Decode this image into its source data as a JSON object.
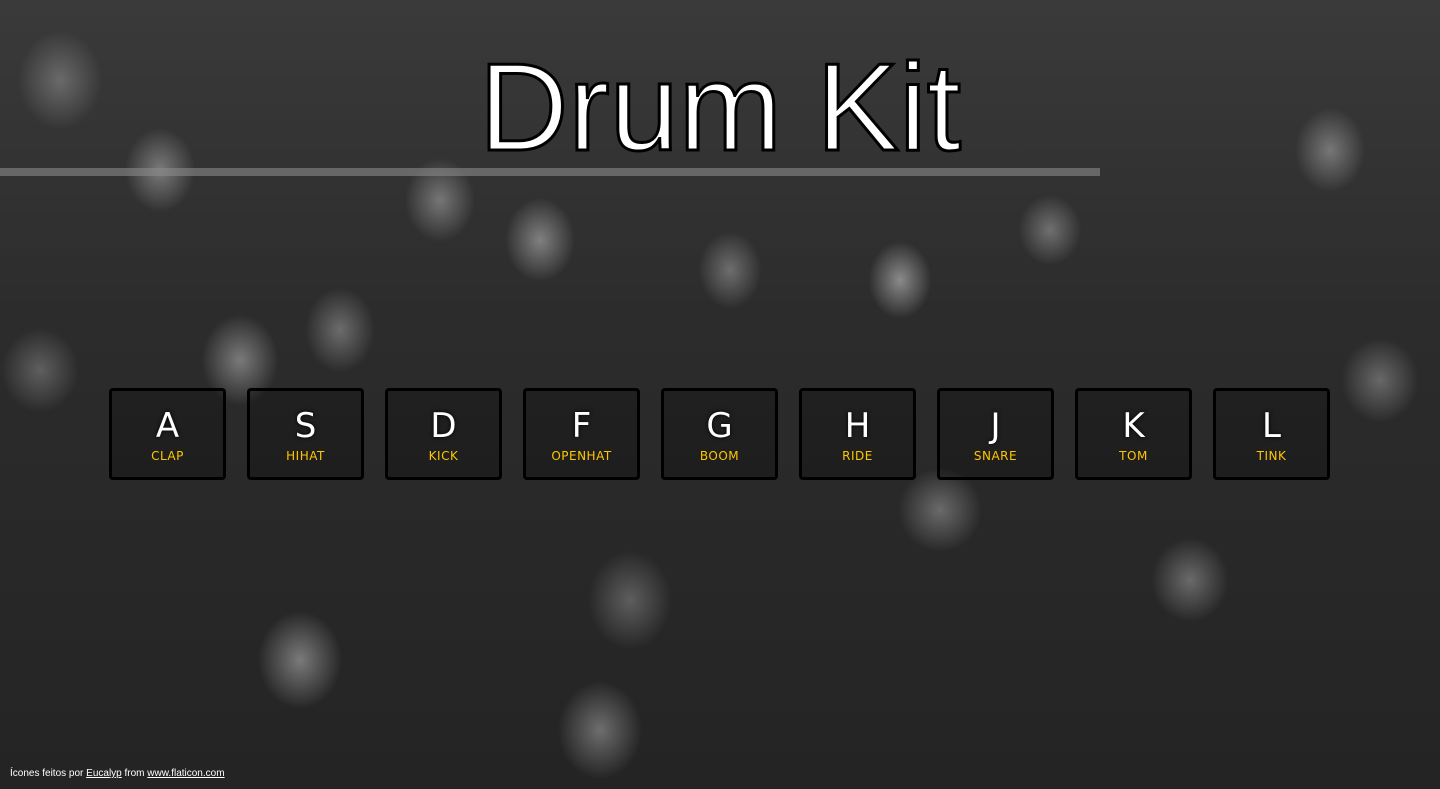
{
  "page": {
    "title": "Drum Kit"
  },
  "keys": [
    {
      "key": "A",
      "sound": "CLAP"
    },
    {
      "key": "S",
      "sound": "HIHAT"
    },
    {
      "key": "D",
      "sound": "KICK"
    },
    {
      "key": "F",
      "sound": "OPENHAT"
    },
    {
      "key": "G",
      "sound": "BOOM"
    },
    {
      "key": "H",
      "sound": "RIDE"
    },
    {
      "key": "J",
      "sound": "SNARE"
    },
    {
      "key": "K",
      "sound": "TOM"
    },
    {
      "key": "L",
      "sound": "TINK"
    }
  ],
  "footer": {
    "prefix": "Ícones feitos por ",
    "author_link": "Eucalyp",
    "middle": " from ",
    "site_link": "www.flaticon.com"
  },
  "colors": {
    "accent": "#ffc600",
    "key_border": "#000000",
    "title_text": "#ffffff"
  }
}
